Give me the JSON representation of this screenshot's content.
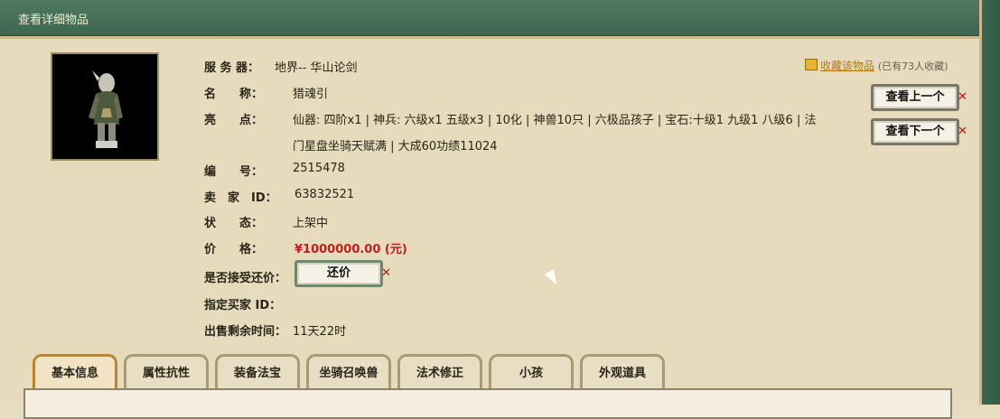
{
  "window": {
    "title": "查看详细物品"
  },
  "item": {
    "server_label": "服 务 器：",
    "server": "地界-- 华山论剑",
    "name_label": "名　　称：",
    "name": "猎魂引",
    "highlights_label": "亮　　点：",
    "highlights_line1": "仙器: 四阶x1 | 神兵: 六级x1 五级x3 | 10化 | 神兽10只 | 六极品孩子 | 宝石:十级1 九级1 八级6 | 法",
    "highlights_line2": "门星盘坐骑天赋满 | 大成60功绩11024",
    "number_label": "编　　号：",
    "number": "2515478",
    "seller_label": "卖　家　ID：",
    "seller_id": "63832521",
    "status_label": "状　　态：",
    "status": "上架中",
    "price_label": "价　　格：",
    "price": "¥1000000.00 (元)",
    "counter_offer_label": "是否接受还价：",
    "counter_offer_button": "还价",
    "buyer_label": "指定买家 ID：",
    "time_left_label": "出售剩余时间：",
    "time_left": "11天22时"
  },
  "favorite": {
    "link": "收藏该物品",
    "count": "(已有73人收藏)"
  },
  "nav": {
    "prev": "查看上一个",
    "next": "查看下一个"
  },
  "tabs": [
    "基本信息",
    "属性抗性",
    "装备法宝",
    "坐骑召唤兽",
    "法术修正",
    "小孩",
    "外观道具"
  ],
  "colors": {
    "accent": "#3c6650",
    "price": "#c21c1c"
  }
}
